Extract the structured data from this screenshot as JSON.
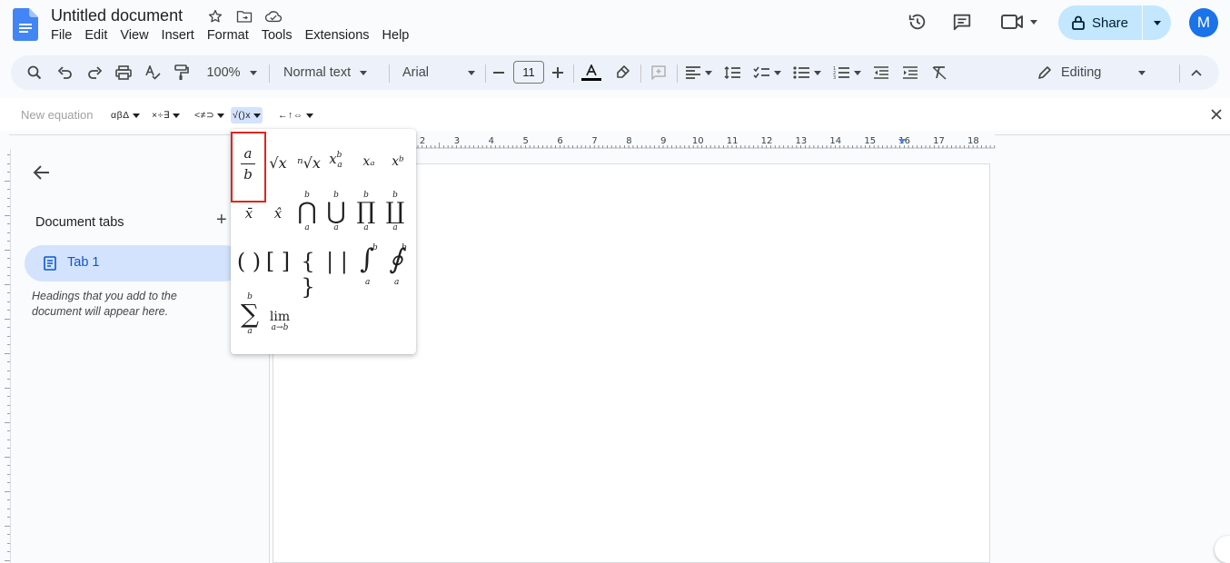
{
  "doc": {
    "title": "Untitled document"
  },
  "menu": [
    "File",
    "Edit",
    "View",
    "Insert",
    "Format",
    "Tools",
    "Extensions",
    "Help"
  ],
  "share": {
    "label": "Share"
  },
  "avatar": {
    "initial": "M"
  },
  "toolbar": {
    "zoom": "100%",
    "style": "Normal text",
    "font": "Arial",
    "font_size": "11",
    "mode": "Editing"
  },
  "equation_bar": {
    "new_equation": "New equation",
    "groups": [
      "αβΔ",
      "×÷∃",
      "<≠⊃",
      "√()x",
      "←↑⇔"
    ]
  },
  "ruler": {
    "numbers": [
      "2",
      "3",
      "4",
      "5",
      "6",
      "7",
      "8",
      "9",
      "10",
      "11",
      "12",
      "13",
      "14",
      "15",
      "16",
      "17",
      "18"
    ]
  },
  "sidebar": {
    "tabs_title": "Document tabs",
    "tab_label": "Tab 1",
    "hint": "Headings that you add to the document will appear here."
  },
  "popup": {
    "frac_num": "a",
    "frac_den": "b",
    "symbols_row1": [
      "√x",
      "ⁿ√x",
      "x",
      "xₐ",
      "xᵇ"
    ],
    "symbols_row2": [
      "x̄",
      "x̂",
      "⋂",
      "⋃",
      "∏",
      "∐"
    ],
    "symbols_row3": [
      "( )",
      "[ ]",
      "{ }",
      "| |",
      "∫",
      "∮"
    ],
    "symbols_row4": [
      "∑",
      "lim"
    ],
    "limit_sub": "a→b",
    "bound_a": "a",
    "bound_b": "b"
  },
  "colors": {
    "accent": "#0b57d0",
    "share_bg": "#c2e7ff",
    "highlight": "#e0251b",
    "avatar": "#1a73e8"
  }
}
